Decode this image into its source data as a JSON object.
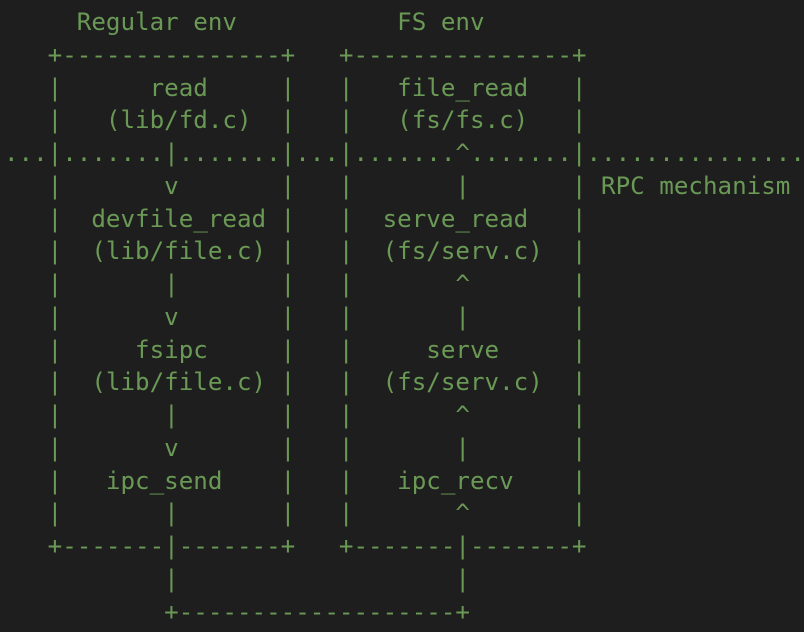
{
  "diagram": {
    "lines": [
      "     Regular env           FS env",
      "   +---------------+   +---------------+",
      "   |      read     |   |   file_read   |",
      "   |   (lib/fd.c)  |   |   (fs/fs.c)   |",
      "...|.......|.......|...|.......^.......|...............",
      "   |       v       |   |       |       | RPC mechanism",
      "   |  devfile_read |   |  serve_read   |",
      "   |  (lib/file.c) |   |  (fs/serv.c)  |",
      "   |       |       |   |       ^       |",
      "   |       v       |   |       |       |",
      "   |     fsipc     |   |     serve     |",
      "   |  (lib/file.c) |   |  (fs/serv.c)  |",
      "   |       |       |   |       ^       |",
      "   |       v       |   |       |       |",
      "   |   ipc_send    |   |   ipc_recv    |",
      "   |       |       |   |       ^       |",
      "   +-------|-------+   +-------|-------+",
      "           |                   |",
      "           +-------------------+"
    ]
  },
  "colors": {
    "background": "#1e1e1e",
    "text": "#6a9955"
  }
}
